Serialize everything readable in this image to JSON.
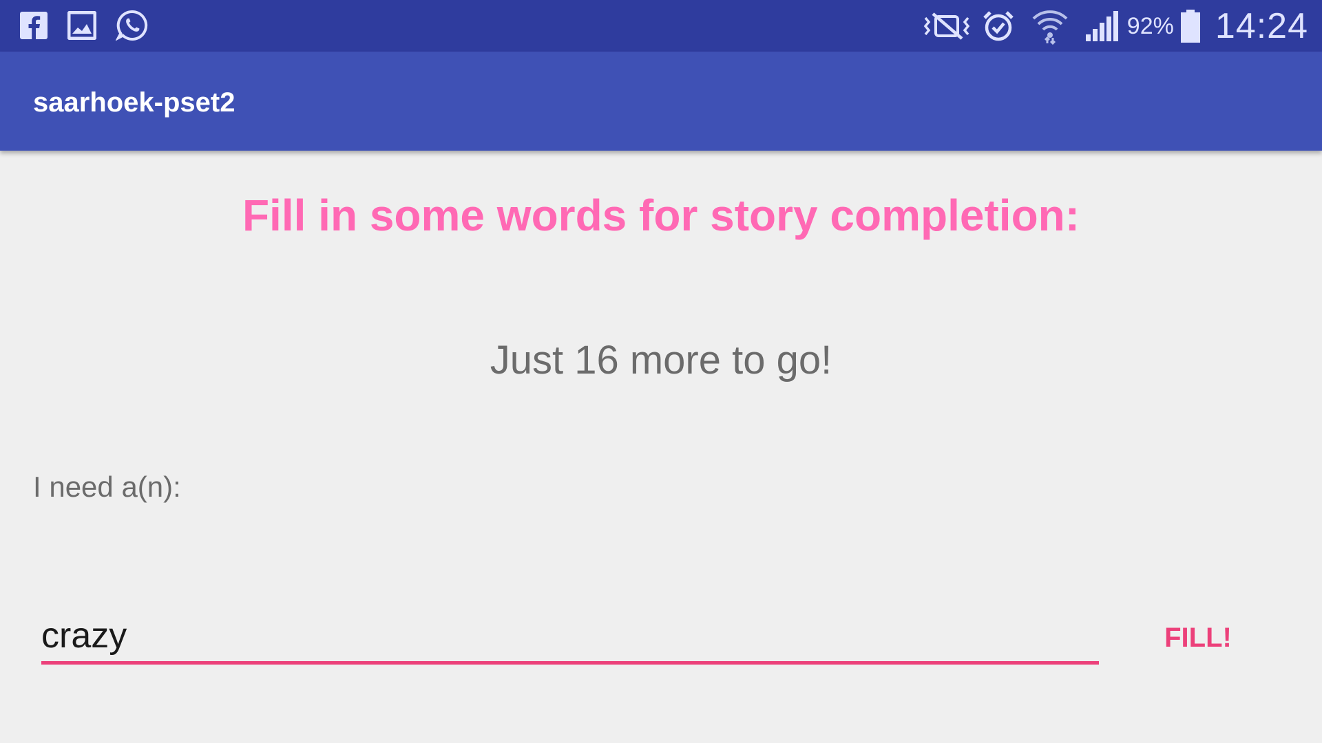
{
  "status_bar": {
    "left_icons": [
      "facebook-icon",
      "gallery-icon",
      "whatsapp-icon"
    ],
    "right_icons": [
      "vibrate-mute-icon",
      "alarm-icon",
      "wifi-icon",
      "signal-icon",
      "battery-icon"
    ],
    "battery_percent": "92%",
    "time": "14:24",
    "background_color": "#2f3c9e"
  },
  "app_bar": {
    "title": "saarhoek-pset2",
    "background_color": "#3f51b5"
  },
  "main": {
    "heading": "Fill in some words for story completion:",
    "remaining_text": "Just 16 more to go!",
    "prompt_label": "I need a(n):",
    "input_value": "crazy",
    "fill_button_label": "FILL!",
    "accent_color": "#ec407a",
    "heading_color": "#ff69b4"
  }
}
